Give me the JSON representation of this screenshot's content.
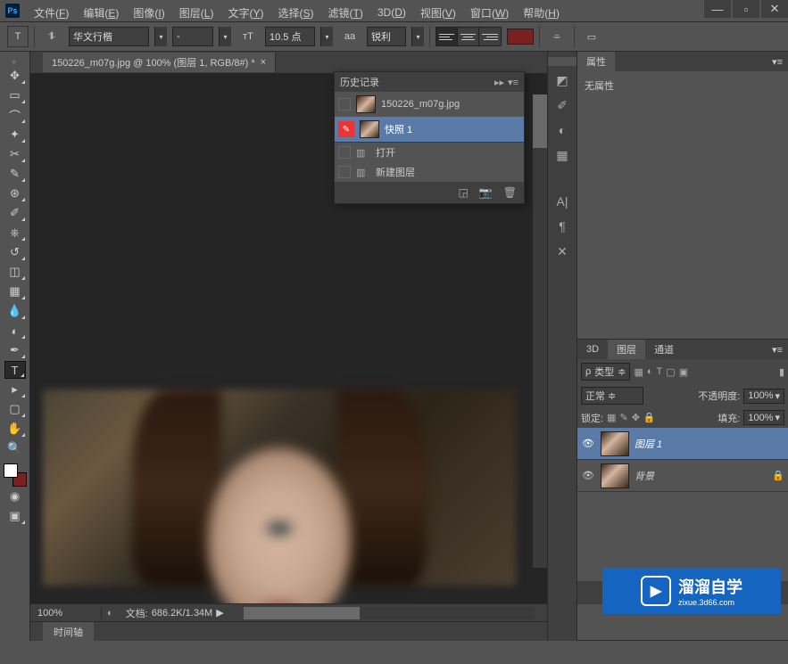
{
  "app": {
    "title": "Ps"
  },
  "window": {
    "minimize": "—",
    "maximize": "▫",
    "close": "✕"
  },
  "menu": [
    {
      "label": "文件",
      "key": "F"
    },
    {
      "label": "编辑",
      "key": "E"
    },
    {
      "label": "图像",
      "key": "I"
    },
    {
      "label": "图层",
      "key": "L"
    },
    {
      "label": "文字",
      "key": "Y"
    },
    {
      "label": "选择",
      "key": "S"
    },
    {
      "label": "滤镜",
      "key": "T"
    },
    {
      "label": "3D",
      "key": "D"
    },
    {
      "label": "视图",
      "key": "V"
    },
    {
      "label": "窗口",
      "key": "W"
    },
    {
      "label": "帮助",
      "key": "H"
    }
  ],
  "options": {
    "tool_glyph": "T",
    "font_family": "华文行楷",
    "font_style": "-",
    "font_size": "10.5 点",
    "aa_label": "aa",
    "antialias": "锐利",
    "swatch_color": "#7a2020"
  },
  "document": {
    "tab_title": "150226_m07g.jpg @ 100% (图层 1, RGB/8#) *",
    "close_glyph": "×"
  },
  "status": {
    "zoom": "100%",
    "doc_label": "文档:",
    "doc_size": "686.2K/1.34M",
    "arrow": "▶"
  },
  "timeline": {
    "label": "时间轴"
  },
  "history": {
    "title": "历史记录",
    "snapshot_file": "150226_m07g.jpg",
    "snapshot_label": "快照 1",
    "steps": [
      {
        "icon": "▥",
        "label": "打开"
      },
      {
        "icon": "▥",
        "label": "新建图层"
      }
    ]
  },
  "properties": {
    "title": "属性",
    "empty_text": "无属性"
  },
  "layers": {
    "tabs": [
      "3D",
      "图层",
      "通道"
    ],
    "active_tab": 1,
    "filter_label": "类型",
    "blend_mode": "正常",
    "opacity_label": "不透明度:",
    "opacity_value": "100%",
    "lock_label": "锁定:",
    "fill_label": "填充:",
    "fill_value": "100%",
    "items": [
      {
        "name": "图层 1",
        "visible": true,
        "selected": true
      },
      {
        "name": "背景",
        "visible": true,
        "selected": false
      }
    ]
  },
  "watermark": {
    "icon": "▶",
    "text": "溜溜自学",
    "sub": "zixue.3d66.com"
  },
  "icons": {
    "search": "🔍",
    "camera": "📷",
    "trash": "🗑",
    "menu": "▾≡",
    "collapse": "◂◂",
    "orient_h": "⇄",
    "orient_v": "T",
    "warp": "⌯",
    "panel": "▭"
  }
}
